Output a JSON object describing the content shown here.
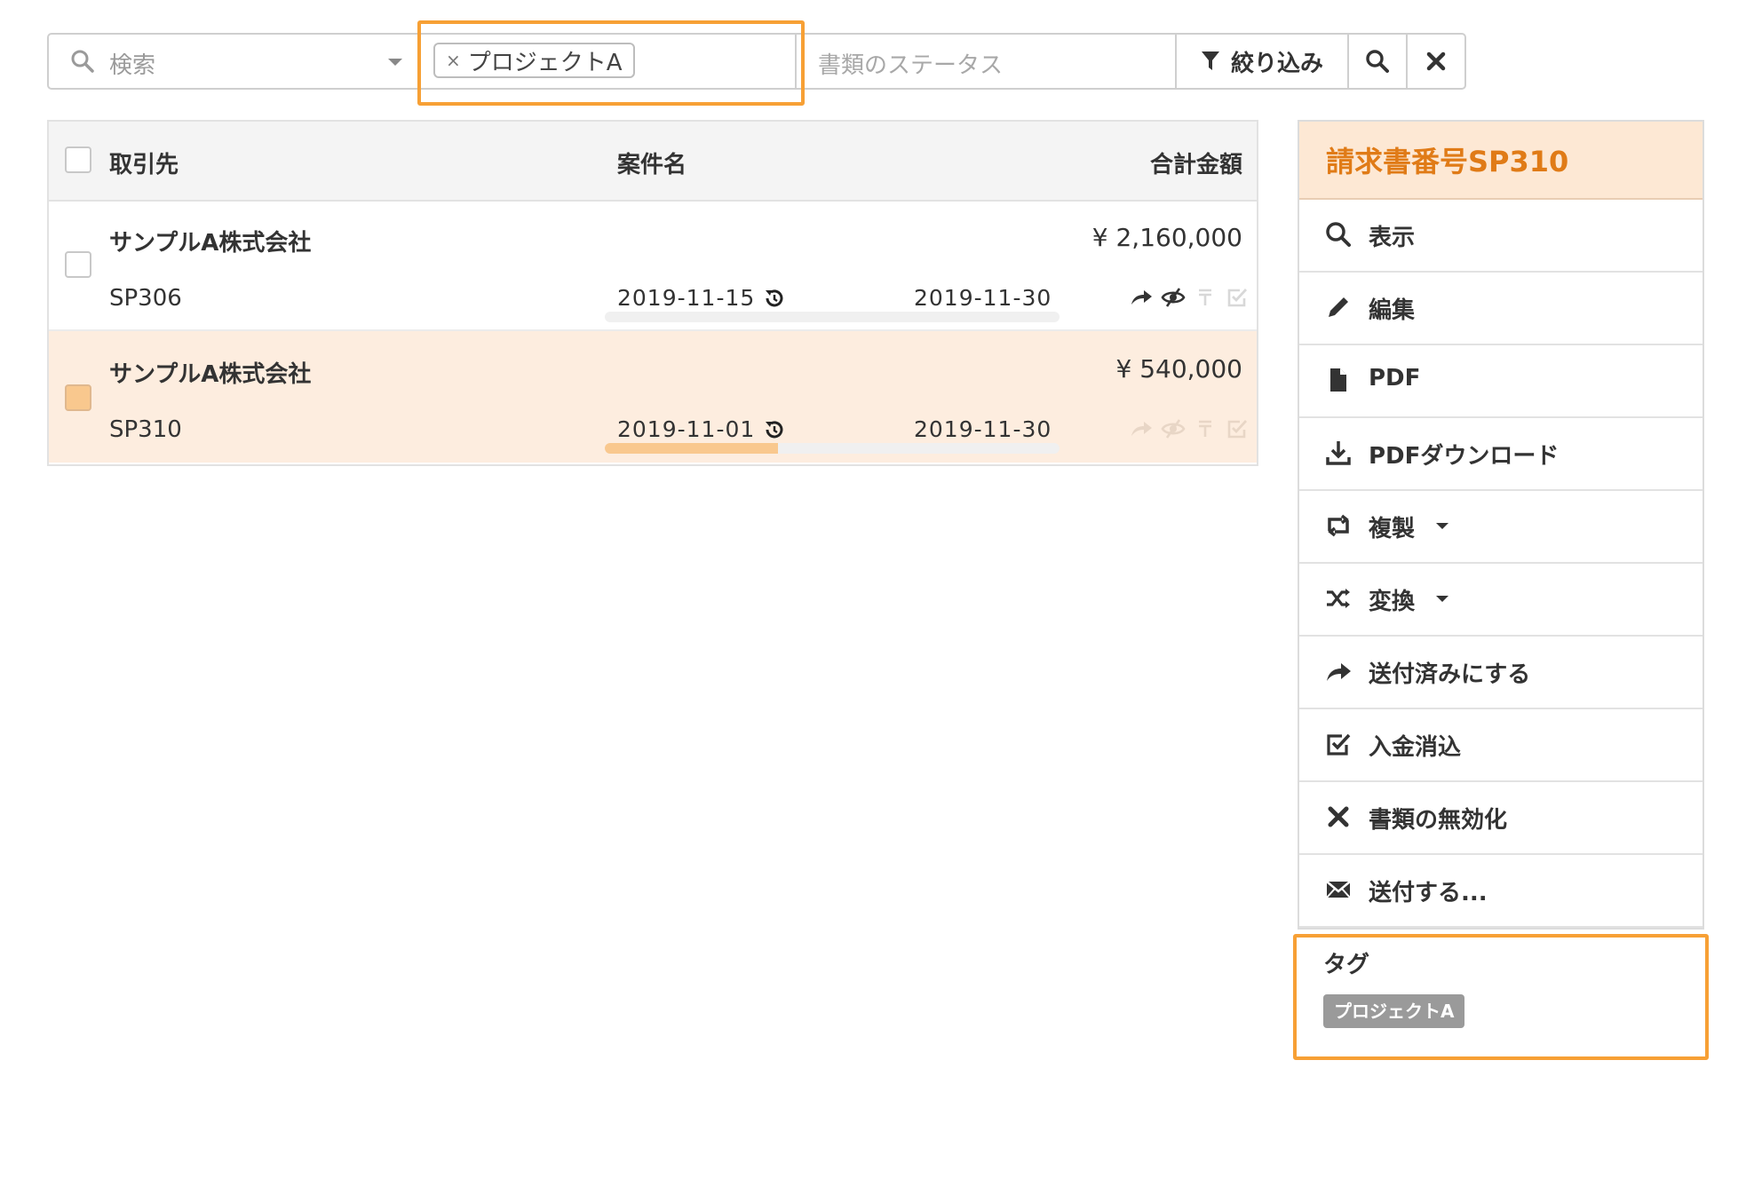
{
  "filter": {
    "search_placeholder": "検索",
    "tag_chip_label": "プロジェクトA",
    "tag_chip_remove": "×",
    "status_placeholder": "書類のステータス",
    "filter_button_label": "絞り込み"
  },
  "table": {
    "headers": {
      "client": "取引先",
      "project": "案件名",
      "total": "合計金額"
    },
    "rows": [
      {
        "client": "サンプルA株式会社",
        "doc_no": "SP306",
        "amount": "¥ 2,160,000",
        "issue_date": "2019-11-15",
        "due_date": "2019-11-30",
        "progress": 0,
        "selected": false
      },
      {
        "client": "サンプルA株式会社",
        "doc_no": "SP310",
        "amount": "¥ 540,000",
        "issue_date": "2019-11-01",
        "due_date": "2019-11-30",
        "progress": 0.38,
        "selected": true
      }
    ]
  },
  "panel": {
    "title": "請求書番号SP310",
    "menu": [
      {
        "label": "表示",
        "icon": "search-icon"
      },
      {
        "label": "編集",
        "icon": "pencil-icon"
      },
      {
        "label": "PDF",
        "icon": "file-icon"
      },
      {
        "label": "PDFダウンロード",
        "icon": "download-icon"
      },
      {
        "label": "複製",
        "icon": "retweet-icon",
        "has_caret": true
      },
      {
        "label": "変換",
        "icon": "shuffle-icon",
        "has_caret": true
      },
      {
        "label": "送付済みにする",
        "icon": "share-arrow-icon"
      },
      {
        "label": "入金消込",
        "icon": "check-square-icon"
      },
      {
        "label": "書類の無効化",
        "icon": "close-icon"
      },
      {
        "label": "送付する...",
        "icon": "envelope-icon"
      }
    ],
    "tags_title": "タグ",
    "tag_badge": "プロジェクトA"
  },
  "colors": {
    "accent_orange": "#f7a035",
    "panel_header_bg": "#fde8d4",
    "panel_title": "#e07b17",
    "selected_row_bg": "#fdeddf",
    "progress_fill": "#f9c88e"
  }
}
